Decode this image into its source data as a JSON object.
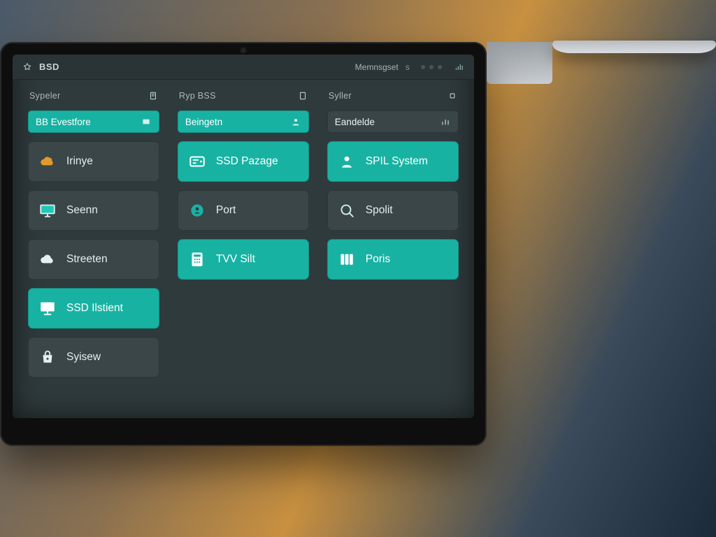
{
  "topbar": {
    "title": "BSD",
    "right_label": "Memnsgset",
    "right_value": "s"
  },
  "columns": [
    {
      "header_label": "Sypeler",
      "header_pill_label": "BB Evestfore",
      "tiles": [
        {
          "label": "Irinye",
          "icon": "cloud-orange",
          "accent": false
        },
        {
          "label": "Seenn",
          "icon": "monitor",
          "accent": false
        },
        {
          "label": "Streeten",
          "icon": "cloud-white",
          "accent": false
        },
        {
          "label": "SSD Ilstient",
          "icon": "desktop",
          "accent": true
        },
        {
          "label": "Syisew",
          "icon": "bag-lock",
          "accent": false
        }
      ]
    },
    {
      "header_label": "Ryp BSS",
      "header_pill_label": "Beingetn",
      "tiles": [
        {
          "label": "SSD Pazage",
          "icon": "card",
          "accent": true
        },
        {
          "label": "Port",
          "icon": "badge",
          "accent": false
        },
        {
          "label": "TVV Silt",
          "icon": "calc",
          "accent": true
        }
      ]
    },
    {
      "header_label": "Syller",
      "header_pill_label": "Eandelde",
      "tiles": [
        {
          "label": "SPIL System",
          "icon": "person",
          "accent": true
        },
        {
          "label": "Spolit",
          "icon": "search",
          "accent": false
        },
        {
          "label": "Poris",
          "icon": "columns",
          "accent": true
        }
      ]
    }
  ]
}
